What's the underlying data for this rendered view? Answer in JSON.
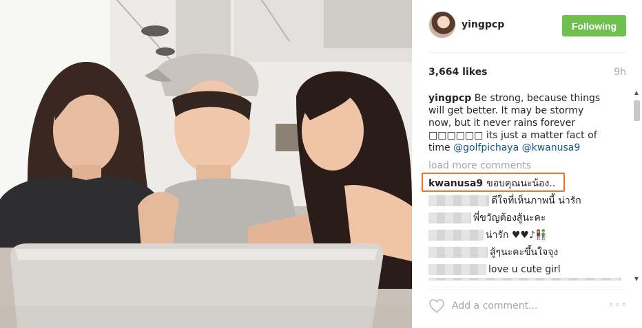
{
  "post": {
    "username": "yingpcp",
    "follow_label": "Following",
    "likes": "3,664 likes",
    "time_ago": "9h",
    "caption": {
      "username": "yingpcp",
      "text": "Be strong, because things will get better. It may be stormy now, but it never rains forever □□□□□□ its just a matter fact of time",
      "mention_1": "@golfpichaya",
      "mention_2": "@kwanusa9"
    },
    "load_more": "load more comments",
    "comments": [
      {
        "username": "kwanusa9",
        "text": "ขอบคุณนะน้อง..",
        "highlighted": true
      },
      {
        "username": "",
        "text": "ดีใจที่เห็นภาพนี้ น่ารัก"
      },
      {
        "username": "",
        "text": "พี่ขวัญต้องสู้นะคะ"
      },
      {
        "username": "",
        "text": "น่ารัก ♥♥♪👫"
      },
      {
        "username": "",
        "text": "สู้ๆนะคะขึ้นใจจุง"
      },
      {
        "username": "",
        "text": "love u cute girl"
      }
    ],
    "add_comment_placeholder": "Add a comment...",
    "more_label": "◦◦◦"
  },
  "colors": {
    "follow_button": "#70c050",
    "mention": "#125688",
    "highlight_box": "#f07226",
    "muted_text": "#a5a7aa"
  },
  "icons": {
    "like": "heart-icon",
    "options": "more-options-icon",
    "scroll_up": "arrow-up-icon",
    "scroll_down": "arrow-down-icon"
  }
}
